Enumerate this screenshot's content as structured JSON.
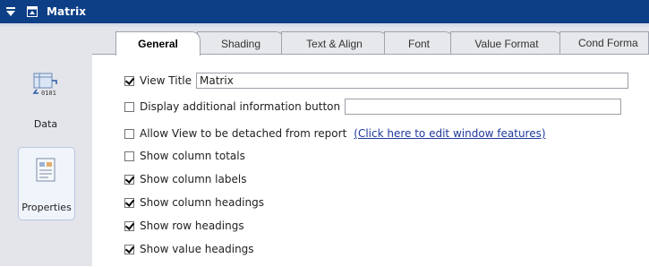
{
  "window": {
    "title": "Matrix"
  },
  "sidebar": {
    "items": [
      {
        "label": "Data",
        "icon": "data-icon"
      },
      {
        "label": "Properties",
        "icon": "properties-icon",
        "selected": true
      }
    ]
  },
  "tabs": [
    {
      "label": "General",
      "active": true
    },
    {
      "label": "Shading"
    },
    {
      "label": "Text & Align"
    },
    {
      "label": "Font"
    },
    {
      "label": "Value Format"
    },
    {
      "label": "Cond Forma"
    }
  ],
  "form": {
    "view_title": {
      "label": "View Title",
      "checked": true,
      "value": "Matrix"
    },
    "display_info": {
      "label": "Display additional information button",
      "checked": false,
      "value": ""
    },
    "allow_detach": {
      "label": "Allow View to be detached from report",
      "checked": false,
      "link": "(Click here to edit window features)"
    },
    "show_column_totals": {
      "label": "Show column totals",
      "checked": false
    },
    "show_column_labels": {
      "label": "Show column labels",
      "checked": true
    },
    "show_column_headings": {
      "label": "Show column headings",
      "checked": true
    },
    "show_row_headings": {
      "label": "Show row headings",
      "checked": true
    },
    "show_value_headings": {
      "label": "Show value headings",
      "checked": true
    }
  },
  "colors": {
    "titlebar": "#0d3f86",
    "sidebar": "#e3e5ea",
    "link": "#1f3a9c"
  }
}
